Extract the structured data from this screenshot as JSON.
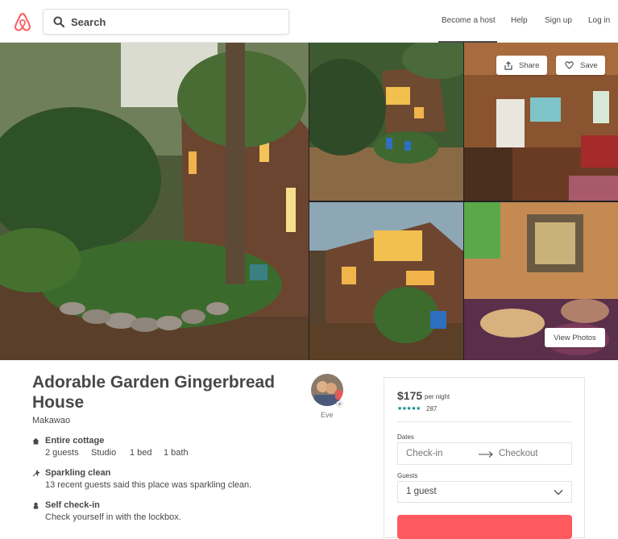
{
  "header": {
    "search_placeholder": "Search",
    "nav": [
      "Become a host",
      "Help",
      "Sign up",
      "Log in"
    ],
    "brand_color": "#FF5A5F"
  },
  "photos": {
    "share_label": "Share",
    "save_label": "Save",
    "view_photos_label": "View Photos"
  },
  "listing": {
    "title": "Adorable Garden Gingerbread House",
    "location": "Makawao",
    "host_name": "Eve",
    "features": [
      {
        "title": "Entire cottage",
        "icon": "home-icon",
        "specs": [
          "2 guests",
          "Studio",
          "1 bed",
          "1 bath"
        ]
      },
      {
        "title": "Sparkling clean",
        "icon": "sparkle-icon",
        "description": "13 recent guests said this place was sparkling clean."
      },
      {
        "title": "Self check-in",
        "icon": "key-icon",
        "description": "Check yourself in with the lockbox."
      }
    ]
  },
  "booking": {
    "price": "$175",
    "per_night": "per night",
    "stars": "★★★★★",
    "rating": 5,
    "review_count": "287",
    "dates_label": "Dates",
    "checkin_placeholder": "Check-in",
    "checkout_placeholder": "Checkout",
    "guests_label": "Guests",
    "guests_value": "1 guest",
    "accent_color": "#008489"
  }
}
